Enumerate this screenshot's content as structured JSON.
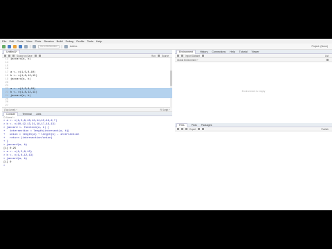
{
  "menubar": [
    "File",
    "Edit",
    "Code",
    "View",
    "Plots",
    "Session",
    "Build",
    "Debug",
    "Profile",
    "Tools",
    "Help"
  ],
  "toolbar": {
    "goto_placeholder": "Go to file/function",
    "addins_label": "Addins",
    "project_label": "Project: (None)"
  },
  "editor": {
    "tab_label": "Untitled1*",
    "toolbar_source_on_save": "Source on Save",
    "run_label": "Run",
    "source_label": "Source",
    "lines": [
      {
        "num": "13",
        "code": "jaccard(a, b)",
        "sel": false
      },
      {
        "num": "14",
        "code": "",
        "sel": false
      },
      {
        "num": "15",
        "code": "",
        "sel": false
      },
      {
        "num": "16",
        "code": "",
        "sel": false
      },
      {
        "num": "17",
        "code": "a <- c(1,5,8,10)",
        "sel": false
      },
      {
        "num": "18",
        "code": "b <- c(1,8,12,13)",
        "sel": false
      },
      {
        "num": "19",
        "code": "jaccard(a, b)",
        "sel": false
      },
      {
        "num": "20",
        "code": "",
        "sel": false
      },
      {
        "num": "21",
        "code": "",
        "sel": false
      },
      {
        "num": "22",
        "code": "a <- c(1,5,8,10)",
        "sel": true
      },
      {
        "num": "23",
        "code": "b <- c(1,8,12,13)",
        "sel": true
      },
      {
        "num": "24",
        "code": "jaccard(a, b)",
        "sel": true
      },
      {
        "num": "25",
        "code": "",
        "sel": false
      },
      {
        "num": "26",
        "code": "",
        "sel": false
      },
      {
        "num": "27",
        "code": "",
        "sel": false
      }
    ],
    "status_left": "(Top Level) ÷",
    "status_right": "R Script ÷"
  },
  "console": {
    "tabs": [
      "Console",
      "Terminal",
      "Jobs"
    ],
    "path": "C:/Users/ ⇨",
    "lines": [
      {
        "t": "> a <- c(1,5,8,10,12,14,15,16,2,7)",
        "out": false
      },
      {
        "t": "> b <- c(10,12,13,21,18,17,19,13)",
        "out": false
      },
      {
        "t": "> jaccard <- function(a, b) {",
        "out": false
      },
      {
        "t": "+   intersection = length(intersect(a, b))",
        "out": false
      },
      {
        "t": "+   union = length(a) + length(b) - intersection",
        "out": false
      },
      {
        "t": "+   return (intersection/union)",
        "out": false
      },
      {
        "t": "+ }",
        "out": false
      },
      {
        "t": "> jaccard(a, b)",
        "out": false
      },
      {
        "t": "[1] 0.25",
        "out": true
      },
      {
        "t": "> a <- c(1,5,8,10)",
        "out": false
      },
      {
        "t": "> b <- c(1,8,12,13)",
        "out": false
      },
      {
        "t": "> jaccard(a, b)",
        "out": false
      },
      {
        "t": "[1] 0",
        "out": true
      },
      {
        "t": ">",
        "out": false
      }
    ]
  },
  "env": {
    "tabs": [
      "Environment",
      "History",
      "Connections",
      "Help",
      "Tutorial",
      "Viewer"
    ],
    "toolbar_import": "Import Dataset",
    "toolbar_list": "List",
    "scope": "Global Environment ÷",
    "empty_text": "Environment is empty"
  },
  "files": {
    "tabs": [
      "Files",
      "Plots",
      "Packages"
    ],
    "toolbar_export": "Export",
    "toolbar_publish": "Publish"
  },
  "colors": {
    "selection": "#b4d2ee",
    "console_input": "#2a2ab0"
  }
}
